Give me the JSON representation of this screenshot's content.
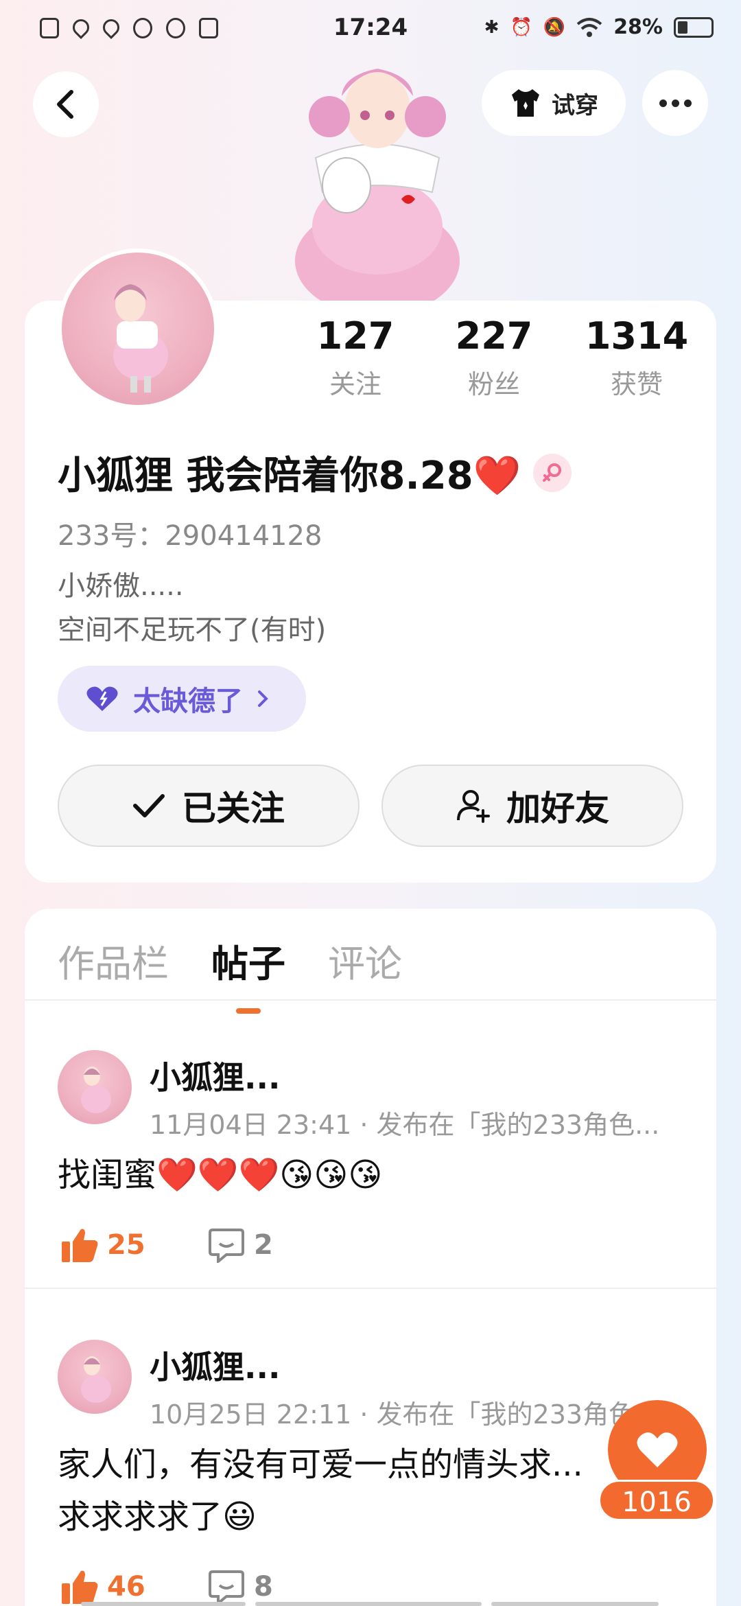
{
  "status_bar": {
    "time": "17:24",
    "battery": "28%",
    "left_icons": [
      "sim-icon",
      "location-icon",
      "location-icon",
      "app-icon",
      "browser-icon",
      "play-icon"
    ],
    "right_icons": [
      "bluetooth-icon",
      "alarm-icon",
      "mute-icon",
      "wifi-icon"
    ]
  },
  "header": {
    "try_on_label": "试穿"
  },
  "profile": {
    "stats": [
      {
        "value": "127",
        "label": "关注"
      },
      {
        "value": "227",
        "label": "粉丝"
      },
      {
        "value": "1314",
        "label": "获赞"
      }
    ],
    "name": "小狐狸 我会陪着你8.28❤️",
    "id_line": "233号：290414128",
    "bio_line1": "小娇傲.....",
    "bio_line2": "空间不足玩不了(有时)",
    "tag_label": "太缺德了",
    "follow_label": "已关注",
    "add_friend_label": "加好友"
  },
  "tabs": [
    "作品栏",
    "帖子",
    "评论"
  ],
  "active_tab": 1,
  "posts": [
    {
      "author": "小狐狸...",
      "meta": "11月04日 23:41 · 发布在「我的233角色...",
      "text": "找闺蜜❤️❤️❤️😘😘😘",
      "likes": "25",
      "comments": "2"
    },
    {
      "author": "小狐狸...",
      "meta": "10月25日 22:11 · 发布在「我的233角色...",
      "text": "家人们，有没有可爱一点的情头求...\n求求求求了😃",
      "likes": "46",
      "comments": "8"
    }
  ],
  "fab": {
    "count": "1016"
  },
  "colors": {
    "accent": "#f26a2e",
    "tag_bg": "#ece9fb",
    "tag_text": "#6a5ad8"
  }
}
